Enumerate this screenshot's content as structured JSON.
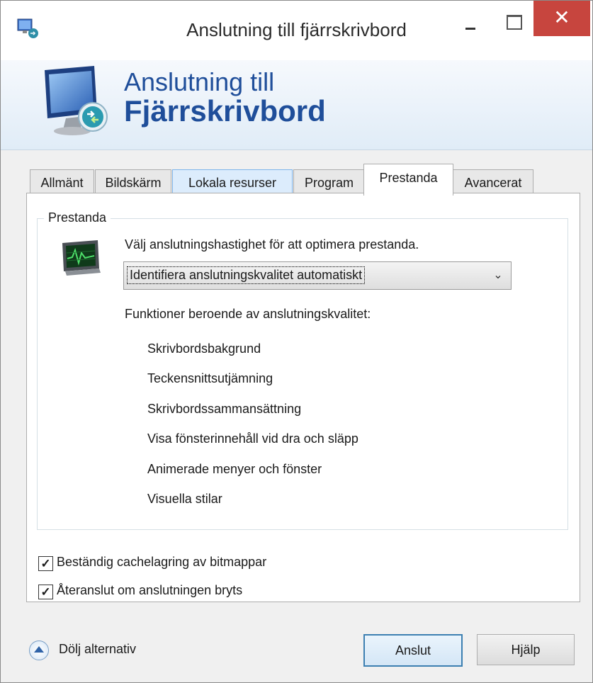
{
  "window": {
    "title": "Anslutning till fjärrskrivbord",
    "close_glyph": "✕"
  },
  "banner": {
    "line1": "Anslutning till",
    "line2": "Fjärrskrivbord"
  },
  "tabs": [
    {
      "label": "Allmänt"
    },
    {
      "label": "Bildskärm"
    },
    {
      "label": "Lokala resurser"
    },
    {
      "label": "Program"
    },
    {
      "label": "Prestanda"
    },
    {
      "label": "Avancerat"
    }
  ],
  "active_tab": "Prestanda",
  "performance": {
    "group_label": "Prestanda",
    "description": "Välj anslutningshastighet för att optimera prestanda.",
    "select_value": "Identifiera anslutningskvalitet automatiskt",
    "select_arrow": "⌄",
    "features_heading": "Funktioner beroende av anslutningskvalitet:",
    "features": [
      "Skrivbordsbakgrund",
      "Teckensnittsutjämning",
      "Skrivbordssammansättning",
      "Visa fönsterinnehåll vid dra och släpp",
      "Animerade menyer och fönster",
      "Visuella stilar"
    ],
    "checkboxes": [
      {
        "label": "Beständig cachelagring av bitmappar",
        "checked": true,
        "mark": "✓"
      },
      {
        "label": "Återanslut om anslutningen bryts",
        "checked": true,
        "mark": "✓"
      }
    ]
  },
  "footer": {
    "toggle_label": "Dölj alternativ",
    "connect_button": "Anslut",
    "help_button": "Hjälp"
  },
  "colors": {
    "banner_text": "#1f4e9a",
    "close_button": "#c7453e",
    "default_button_border": "#3c7fb1"
  },
  "icons": {
    "app": "remote-desktop-icon",
    "banner": "remote-desktop-monitor-icon",
    "performance": "performance-monitor-icon",
    "toggle": "chevron-up-circle-icon"
  }
}
